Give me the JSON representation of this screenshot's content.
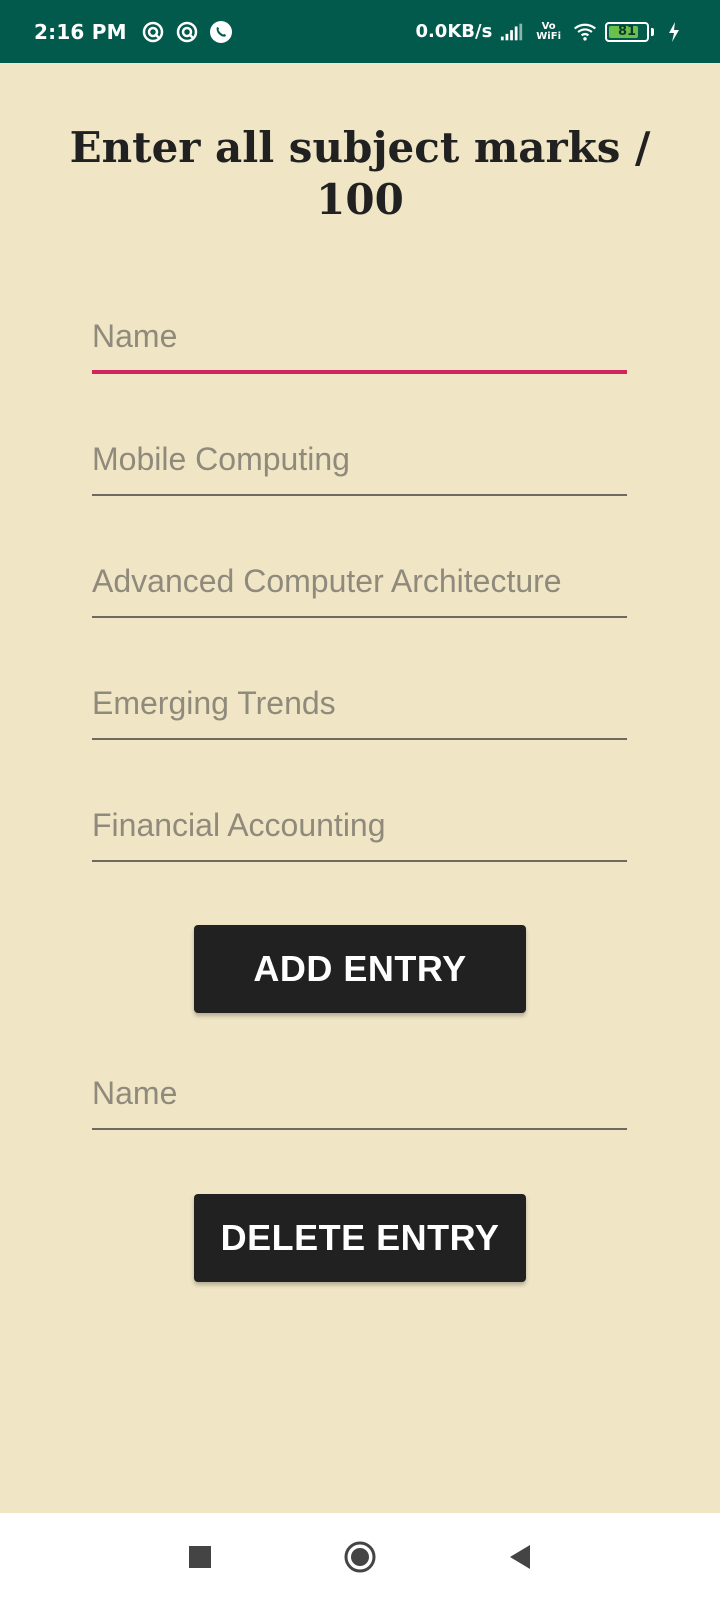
{
  "status_bar": {
    "time": "2:16 PM",
    "net_speed": "0.0KB/s",
    "vowifi_top": "Vo",
    "vowifi_bottom": "WiFi",
    "battery_level": 81,
    "battery_text": "81",
    "icons": [
      "notification-app-icon",
      "notification-app-icon",
      "whatsapp-icon",
      "signal-icon",
      "wifi-icon",
      "battery-icon",
      "charging-icon"
    ],
    "colors": {
      "background": "#025a4c",
      "battery_fill": "#6cc04a"
    }
  },
  "page": {
    "title": "Enter all subject marks / 100",
    "background": "#f0e6c6"
  },
  "form": {
    "name_placeholder": "Name",
    "mobile_computing_placeholder": "Mobile Computing",
    "advanced_computer_architecture_placeholder": "Advanced Computer Architecture",
    "emerging_trends_placeholder": "Emerging Trends",
    "financial_accounting_placeholder": "Financial Accounting",
    "add_entry_label": "ADD ENTRY",
    "delete_name_placeholder": "Name",
    "delete_entry_label": "DELETE ENTRY",
    "focus_color": "#d0245f"
  },
  "nav_bar": {
    "icons": [
      "recents-square-icon",
      "home-circle-icon",
      "back-triangle-icon"
    ]
  }
}
